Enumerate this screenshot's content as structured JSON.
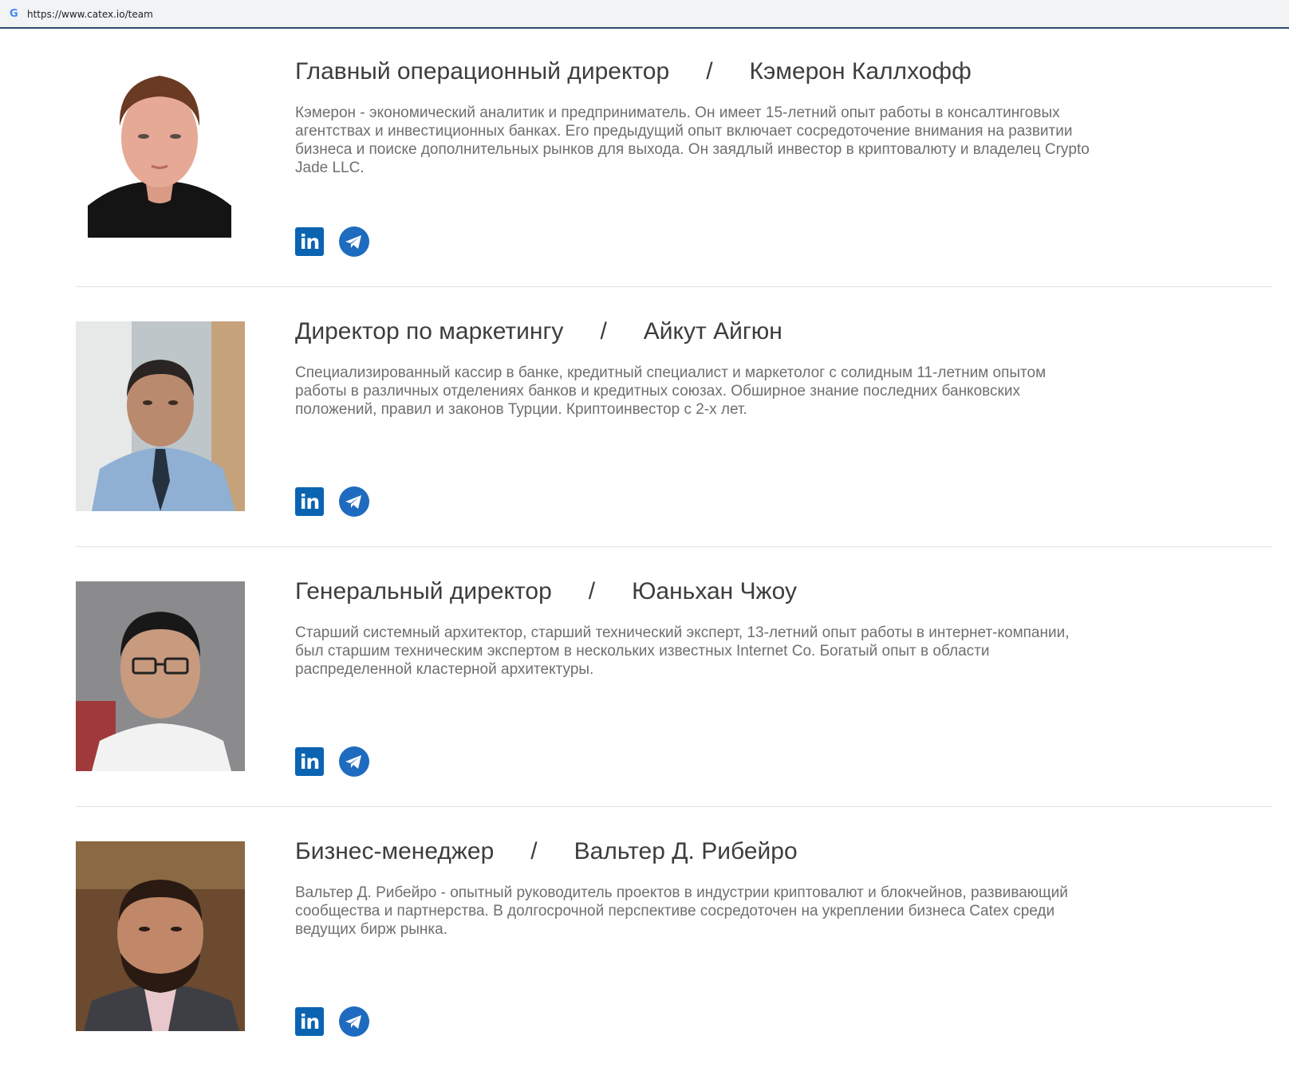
{
  "browser": {
    "favicon": "google-g-icon",
    "url": "https://www.catex.io/team"
  },
  "team": [
    {
      "role": "Главный операционный директор",
      "name": "Кэмерон Каллхофф",
      "bio": "Кэмерон - экономический аналитик и предприниматель. Он имеет 15-летний опыт работы в консалтинговых агентствах и инвестиционных банках. Его предыдущий опыт включает сосредоточение внимания на развитии бизнеса и поиске дополнительных рынков для выхода. Он заядлый инвестор в криптовалюту и владелец Crypto Jade LLC."
    },
    {
      "role": "Директор по маркетингу",
      "name": "Айкут Айгюн",
      "bio": "Специализированный кассир в банке, кредитный специалист и маркетолог с солидным 11-летним опытом работы в различных отделениях банков и кредитных союзах. Обширное знание последних банковских положений, правил и законов Турции. Криптоинвестор с 2-х лет."
    },
    {
      "role": "Генеральный директор",
      "name": "Юаньхан Чжоу",
      "bio": "Старший системный архитектор, старший технический эксперт, 13-летний опыт работы в интернет-компании, был старшим техническим экспертом в нескольких известных Internet Co. Богатый опыт в области распределенной кластерной архитектуры."
    },
    {
      "role": "Бизнес-менеджер",
      "name": "Вальтер Д. Рибейро",
      "bio": "Вальтер Д. Рибейро - опытный руководитель проектов в индустрии криптовалют и блокчейнов, развивающий сообщества и партнерства. В долгосрочной перспективе сосредоточен на укреплении бизнеса Catex среди ведущих бирж рынка."
    }
  ],
  "separator": "/",
  "social": {
    "linkedin_label": "in",
    "linkedin_icon": "linkedin-icon",
    "telegram_icon": "telegram-icon"
  },
  "colors": {
    "linkedin": "#0b64b1",
    "telegram": "#1e6bbf",
    "heading": "#3d3d3d",
    "bio": "#6f6f6f"
  }
}
